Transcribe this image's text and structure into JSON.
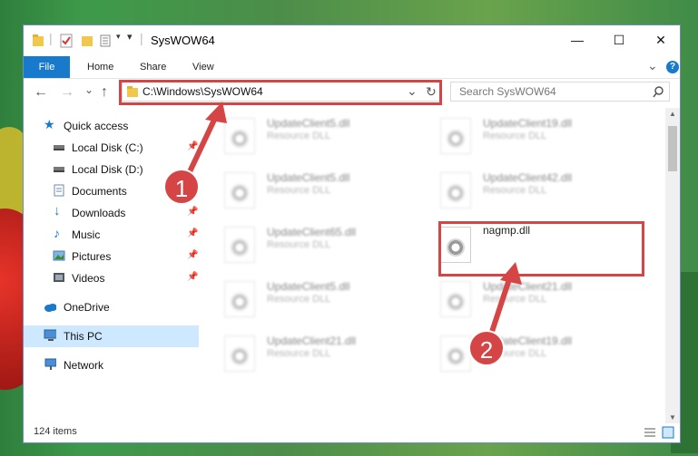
{
  "window": {
    "title": "SysWOW64",
    "controls": {
      "minimize": "—",
      "maximize": "☐",
      "close": "✕"
    }
  },
  "ribbon": {
    "tabs": [
      "File",
      "Home",
      "Share",
      "View"
    ],
    "expand_icon": "⌄",
    "help_icon": "?"
  },
  "navigation": {
    "back": "←",
    "forward": "→",
    "recent": "⌄",
    "up": "↑",
    "address": "C:\\Windows\\SysWOW64",
    "dropdown": "⌄",
    "refresh": "↻",
    "search_placeholder": "Search SysWOW64"
  },
  "sidebar": {
    "items": [
      {
        "label": "Quick access",
        "icon": "star-icon",
        "pinned": false
      },
      {
        "label": "Local Disk (C:)",
        "icon": "drive-icon",
        "pinned": true
      },
      {
        "label": "Local Disk (D:)",
        "icon": "drive-icon",
        "pinned": false
      },
      {
        "label": "Documents",
        "icon": "documents-icon",
        "pinned": true
      },
      {
        "label": "Downloads",
        "icon": "downloads-icon",
        "pinned": true
      },
      {
        "label": "Music",
        "icon": "music-icon",
        "pinned": true
      },
      {
        "label": "Pictures",
        "icon": "pictures-icon",
        "pinned": true
      },
      {
        "label": "Videos",
        "icon": "videos-icon",
        "pinned": true
      },
      {
        "label": "OneDrive",
        "icon": "cloud-icon",
        "pinned": false
      },
      {
        "label": "This PC",
        "icon": "computer-icon",
        "pinned": false,
        "selected": true
      },
      {
        "label": "Network",
        "icon": "network-icon",
        "pinned": false
      }
    ]
  },
  "files": [
    {
      "name": "UpdateClient5.dll",
      "type": "Resource DLL"
    },
    {
      "name": "UpdateClient19.dll",
      "type": "Resource DLL"
    },
    {
      "name": "UpdateClient5.dll",
      "type": "Resource DLL"
    },
    {
      "name": "UpdateClient42.dll",
      "type": "Resource DLL"
    },
    {
      "name": "UpdateClient65.dll",
      "type": "Resource DLL"
    },
    {
      "name": "nagmp.dll",
      "type": ""
    },
    {
      "name": "UpdateClient5.dll",
      "type": "Resource DLL"
    },
    {
      "name": "UpdateClient21.dll",
      "type": "Resource DLL"
    },
    {
      "name": "UpdateClient21.dll",
      "type": "Resource DLL"
    },
    {
      "name": "UpdateClient19.dll",
      "type": "Resource DLL"
    }
  ],
  "status": {
    "count": "124 items"
  },
  "annotations": {
    "step1": "1",
    "step2": "2"
  },
  "colors": {
    "accent": "#1979ca",
    "highlight": "#d64545",
    "selected": "#cde8ff"
  }
}
